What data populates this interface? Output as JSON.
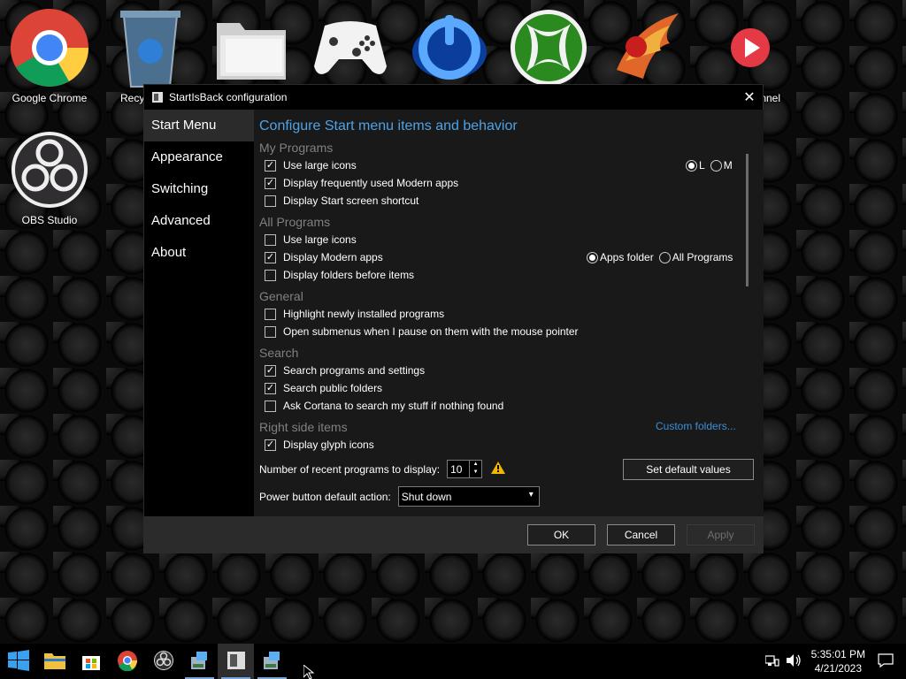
{
  "desktop": {
    "icons": [
      {
        "label": "Google Chrome",
        "icon": "chrome-icon"
      },
      {
        "label": "Recy",
        "icon": "recycle-bin-icon"
      },
      {
        "label": "",
        "icon": "folder-icon"
      },
      {
        "label": "",
        "icon": "xbox-controller-icon"
      },
      {
        "label": "",
        "icon": "power-app-icon"
      },
      {
        "label": "",
        "icon": "xbox-icon"
      },
      {
        "label": "",
        "icon": "phoenix-icon"
      },
      {
        "label": "nnel",
        "icon": "play-channel-icon"
      },
      {
        "label": "OBS Studio",
        "icon": "obs-icon"
      }
    ]
  },
  "window": {
    "title": "StartIsBack configuration",
    "close": "✕",
    "sidebar": [
      "Start Menu",
      "Appearance",
      "Switching",
      "Advanced",
      "About"
    ],
    "heading": "Configure Start menu items and behavior",
    "sections": {
      "my_programs": "My Programs",
      "all_programs": "All Programs",
      "general": "General",
      "search": "Search",
      "right_side": "Right side items"
    },
    "options": {
      "mp_large_icons": "Use large icons",
      "mp_frequent_modern": "Display frequently used Modern apps",
      "mp_start_screen": "Display Start screen shortcut",
      "ap_large_icons": "Use large icons",
      "ap_modern_apps": "Display Modern apps",
      "ap_folders_before": "Display folders before items",
      "gen_highlight": "Highlight newly installed programs",
      "gen_open_submenus": "Open submenus when I pause on them with the mouse pointer",
      "srch_programs": "Search programs and settings",
      "srch_public": "Search public folders",
      "srch_cortana": "Ask Cortana to search my stuff if nothing found",
      "rs_glyph": "Display glyph icons"
    },
    "checks": "✓",
    "radios": {
      "size_l": "L",
      "size_m": "M",
      "apps_folder": "Apps folder",
      "all_programs": "All Programs"
    },
    "custom_folders": "Custom folders...",
    "recent_label": "Number of recent programs to display:",
    "recent_value": "10",
    "power_label": "Power button default action:",
    "power_value": "Shut down",
    "set_default": "Set default values",
    "ok": "OK",
    "cancel": "Cancel",
    "apply": "Apply"
  },
  "taskbar": {
    "time": "5:35:01 PM",
    "date": "4/21/2023"
  },
  "colors": {
    "accent": "#4ea2e5",
    "link": "#3c8fd6",
    "section": "#808080"
  }
}
